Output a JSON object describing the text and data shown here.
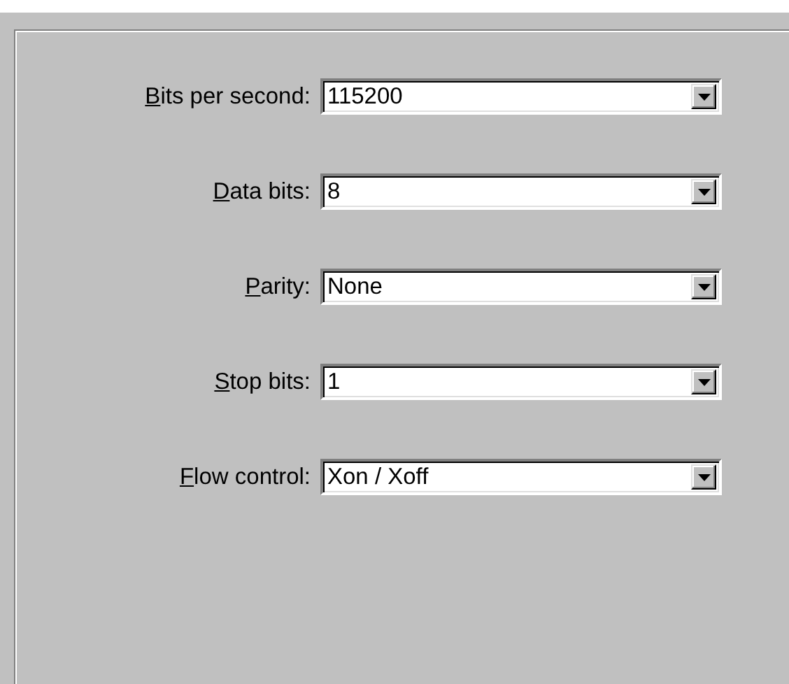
{
  "settings": [
    {
      "label": "Bits per second:",
      "value": "115200"
    },
    {
      "label": "Data bits:",
      "value": "8"
    },
    {
      "label": "Parity:",
      "value": "None"
    },
    {
      "label": "Stop bits:",
      "value": "1"
    },
    {
      "label": "Flow control:",
      "value": "Xon / Xoff"
    }
  ]
}
